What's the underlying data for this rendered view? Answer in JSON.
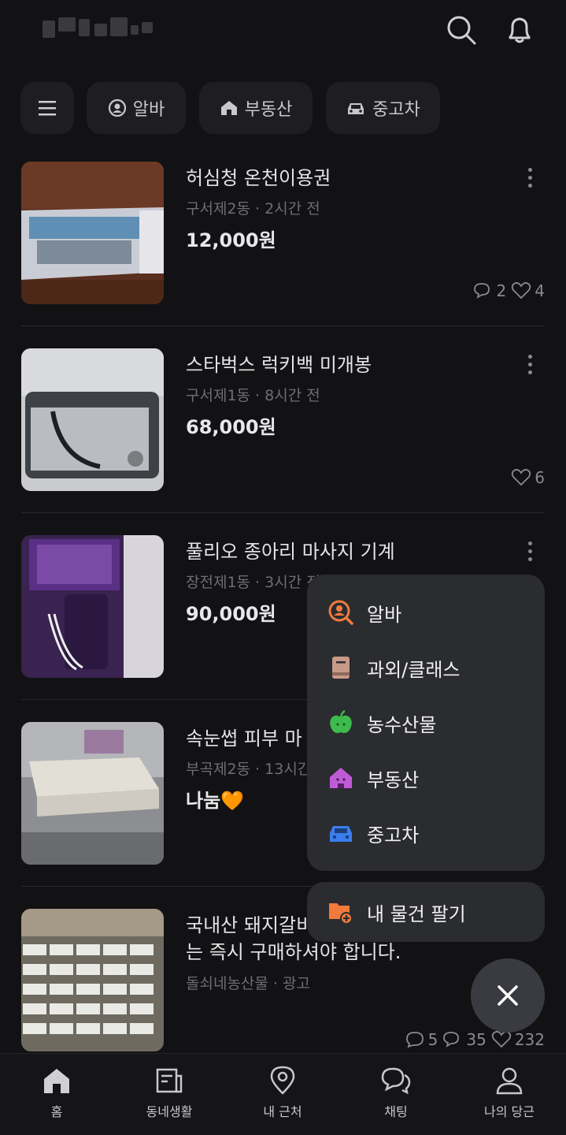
{
  "header": {
    "search_icon": "search-icon",
    "bell_icon": "bell-icon"
  },
  "chips": [
    {
      "label": "",
      "icon": "menu-icon"
    },
    {
      "label": "알바",
      "icon": "person-circle-icon"
    },
    {
      "label": "부동산",
      "icon": "house-icon"
    },
    {
      "label": "중고차",
      "icon": "car-icon"
    }
  ],
  "listings": [
    {
      "title": "허심청 온천이용권",
      "location": "구서제2동",
      "time": "2시간 전",
      "price": "12,000원",
      "chats": "2",
      "likes": "4"
    },
    {
      "title": "스타벅스 럭키백 미개봉",
      "location": "구서제1동",
      "time": "8시간 전",
      "price": "68,000원",
      "chats": "",
      "likes": "6"
    },
    {
      "title": "풀리오 종아리 마사지 기계",
      "location": "장전제1동",
      "time": "3시간 전",
      "price": "90,000원",
      "chats": "",
      "likes": ""
    },
    {
      "title": "속눈썹 피부 마",
      "location": "부곡제2동",
      "time": "13시간 전",
      "price": "나눔🧡",
      "chats": "",
      "likes": ""
    },
    {
      "title": "국내산 돼지갈비",
      "title2": "는 즉시 구매하셔야 합니다.",
      "location": "돌쇠네농산물",
      "time": "광고",
      "price": "",
      "comments": "5",
      "chats": "35",
      "likes": "232"
    }
  ],
  "menu": {
    "items": [
      {
        "label": "알바",
        "icon": "job-search-icon",
        "color": "#f07b3c"
      },
      {
        "label": "과외/클래스",
        "icon": "book-icon",
        "color": "#c79a88"
      },
      {
        "label": "농수산물",
        "icon": "apple-icon",
        "color": "#3dbb4c"
      },
      {
        "label": "부동산",
        "icon": "house-icon",
        "color": "#c05bd8"
      },
      {
        "label": "중고차",
        "icon": "car-icon",
        "color": "#3b7ef0"
      }
    ],
    "sell_label": "내 물건 팔기",
    "sell_icon": "folder-plus-icon"
  },
  "bottom_nav": [
    {
      "label": "홈",
      "icon": "home-icon"
    },
    {
      "label": "동네생활",
      "icon": "newspaper-icon"
    },
    {
      "label": "내 근처",
      "icon": "location-pin-icon"
    },
    {
      "label": "채팅",
      "icon": "chat-icon"
    },
    {
      "label": "나의 당근",
      "icon": "person-icon"
    }
  ]
}
